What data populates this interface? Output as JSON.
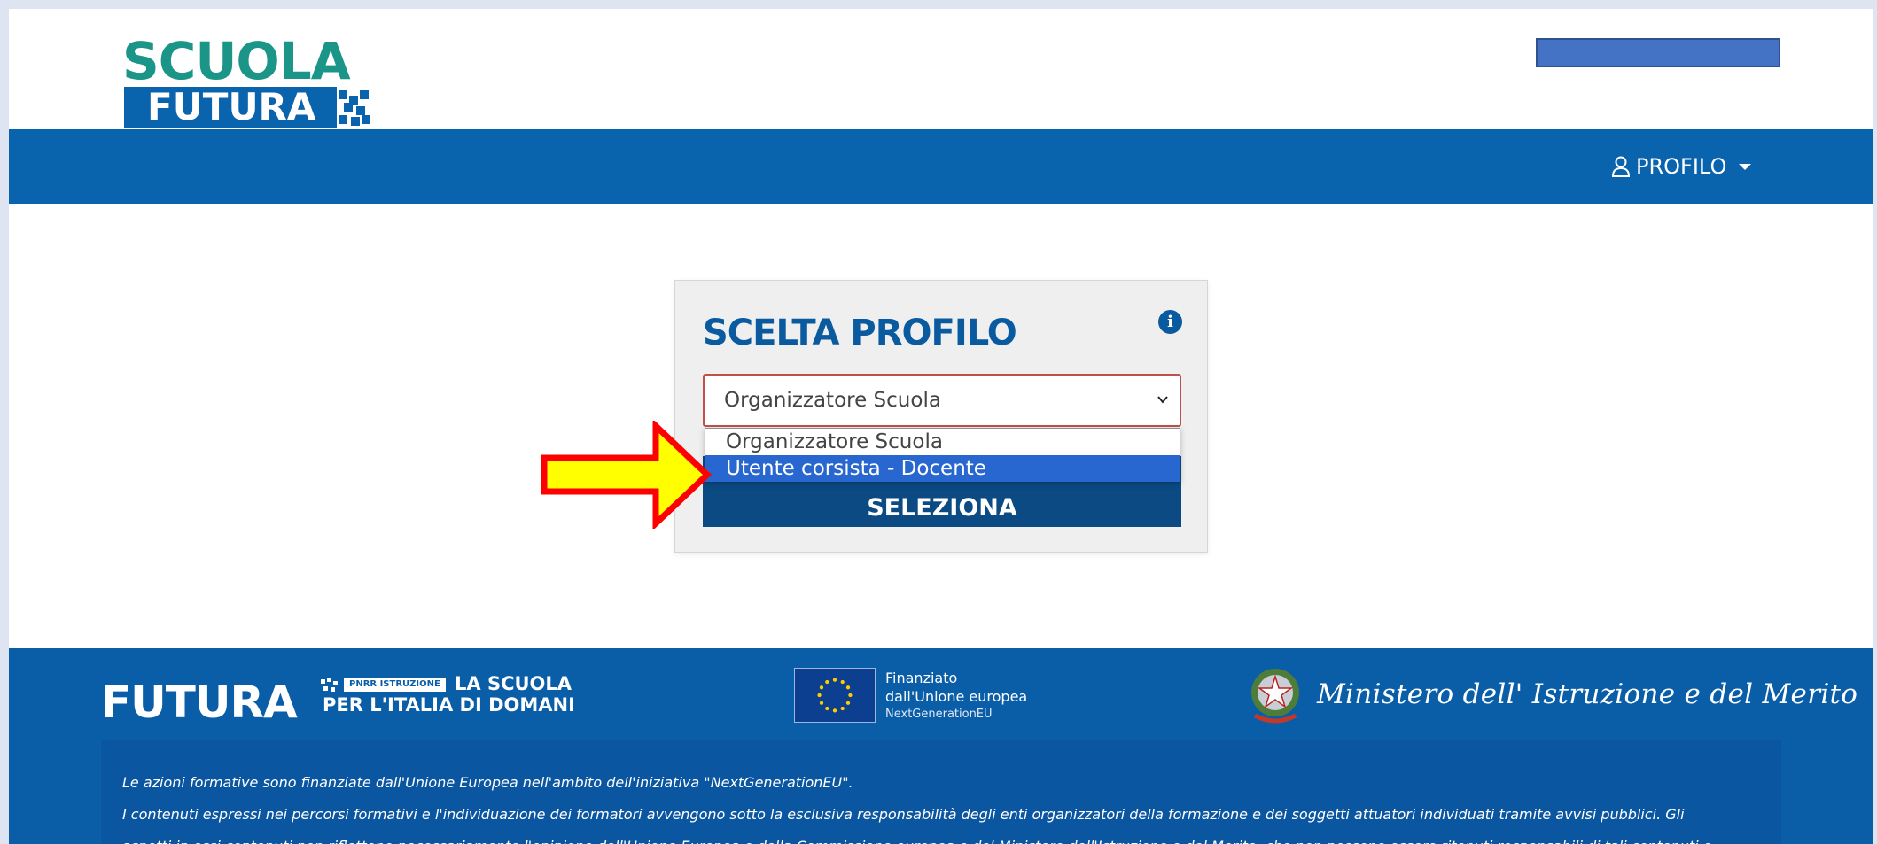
{
  "header": {
    "logo_line1": "SCUOLA",
    "logo_line2": "FUTURA",
    "profile_menu_label": "PROFILO"
  },
  "card": {
    "title": "SCELTA PROFILO",
    "select_value": "Organizzatore Scuola",
    "options": [
      "Organizzatore Scuola",
      "Utente corsista - Docente"
    ],
    "highlighted_option": "Utente corsista - Docente",
    "button_label": "SELEZIONA"
  },
  "footer": {
    "brand": "FUTURA",
    "pnrr_tag": "PNRR ISTRUZIONE",
    "tagline_line1": "LA SCUOLA",
    "tagline_line2": "PER L'ITALIA DI DOMANI",
    "eu_line1": "Finanziato",
    "eu_line2": "dall'Unione europea",
    "eu_line3": "NextGenerationEU",
    "ministry": "Ministero dell' Istruzione e del Merito",
    "disclaimer": [
      "Le azioni formative sono finanziate dall'Unione Europea nell'ambito dell'iniziativa \"NextGenerationEU\".",
      "I contenuti espressi nei percorsi formativi e l'individuazione dei formatori avvengono sotto la esclusiva responsabilità degli enti organizzatori della formazione e dei soggetti attuatori individuati tramite avvisi pubblici. Gli",
      "aspetti in essi contenuti non riflettono necessariamente l'opinione dell'Unione Europea o della Commissione europea o del Ministero dell'Istruzione e del Merito, che non possono essere ritenuti responsabili di tali contenuti e"
    ]
  },
  "colors": {
    "primary_blue": "#0a63ad",
    "teal": "#1b9587",
    "highlight": "#2866d0",
    "arrow_fill": "#ffff00",
    "arrow_stroke": "#ff0000"
  }
}
